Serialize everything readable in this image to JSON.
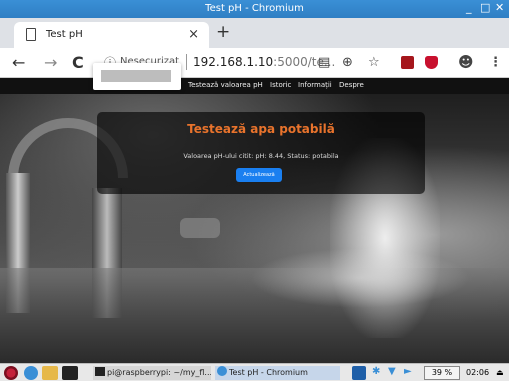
{
  "window": {
    "title": "Test pH - Chromium"
  },
  "tab": {
    "label": "Test pH",
    "close": "×",
    "new_tab": "+"
  },
  "toolbar": {
    "back": "←",
    "forward": "→",
    "reload": "C",
    "insecure_label": "Nesecurizat",
    "url_host": "192.168.1.10",
    "url_rest": ":5000/te...",
    "icons": [
      "translate-icon",
      "zoom-icon",
      "star-icon",
      "extension-icon",
      "ublock-icon",
      "profile-icon",
      "menu-icon"
    ]
  },
  "site": {
    "nav": [
      "Testează valoarea pH",
      "Istoric",
      "Informații",
      "Despre"
    ],
    "heading": "Testează apa potabilă",
    "result": "Valoarea pH-ului citit: pH: 8.44, Status: potabila",
    "button": "Actualizează"
  },
  "taskbar": {
    "task1": "pi@raspberrypi: ~/my_fl...",
    "task2": "Test pH - Chromium",
    "battery": "39 %",
    "time": "02:06"
  },
  "colors": {
    "accent": "#e8732c",
    "button": "#1a7ff0",
    "titlebar": "#2f7fc4"
  }
}
